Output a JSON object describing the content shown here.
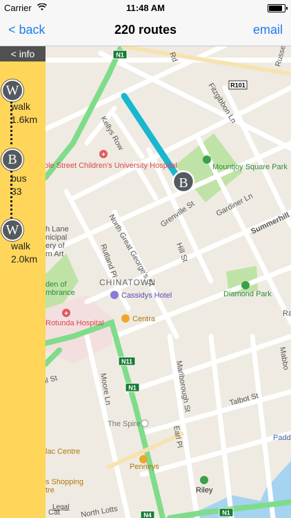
{
  "status": {
    "carrier": "Carrier",
    "time": "11:48 AM",
    "battery_level": 0.85
  },
  "nav": {
    "back_label": "< back",
    "title": "220 routes",
    "email_label": "email"
  },
  "sidebar": {
    "info_label": "< info",
    "steps": [
      {
        "icon": "W",
        "mode": "walk",
        "detail": "1.6km"
      },
      {
        "icon": "B",
        "mode": "bus",
        "detail": "33"
      },
      {
        "icon": "W",
        "mode": "walk",
        "detail": "2.0km"
      }
    ]
  },
  "map": {
    "route_color": "#19b6d0",
    "route_marker": "B",
    "roads": [
      "N1",
      "R101",
      "N11",
      "N1",
      "N4",
      "N1"
    ],
    "streets": [
      "Kellys Row",
      "Fitzgibbon Ln",
      "Grenville St",
      "Gardiner Ln",
      "North Great George's St",
      "Rutland Pl",
      "Hill St",
      "Summerhill",
      "Moore Ln",
      "Marlborough St",
      "Earl Pl",
      "Talbot St",
      "North Lotts",
      "Russell",
      "Rd",
      "Ra",
      "Mabbo",
      "Paddi",
      "ll St",
      "Cat"
    ],
    "pois": [
      "Temple Street Children's University Hospital",
      "Mountjoy Square Park",
      "Cassidys Hotel",
      "Centra",
      "Diamond Park",
      "The Spire",
      "Penneys",
      "Riley",
      "Rotunda Hospital",
      "CHINATOWN"
    ],
    "partial_labels": [
      "h Lane",
      "nicipal",
      "ery of",
      "rn Art",
      "den of",
      "mbrance",
      "lac Centre",
      "s Shopping",
      "tre"
    ],
    "legal": "Legal"
  }
}
